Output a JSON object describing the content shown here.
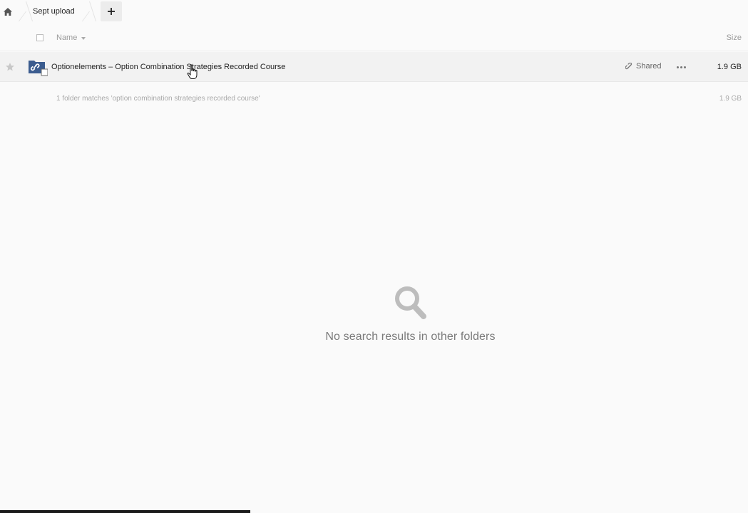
{
  "breadcrumb": {
    "home_icon": "home-icon",
    "folder": "Sept upload",
    "add_icon": "plus-icon"
  },
  "table": {
    "columns": {
      "name": "Name",
      "size": "Size"
    },
    "rows": [
      {
        "name": "Optionelements – Option Combination Strategies Recorded Course",
        "type_icon": "shared-folder-icon",
        "shared_label": "Shared",
        "shared_icon": "link-icon",
        "actions_icon": "more-icon",
        "size": "1.9 GB"
      }
    ]
  },
  "summary": {
    "text": "1 folder matches 'option combination strategies recorded course'",
    "size": "1.9 GB"
  },
  "empty_state": {
    "icon": "search-icon",
    "message": "No search results in other folders"
  },
  "progress": {
    "fraction": 0.335
  },
  "colors": {
    "background": "#fafafa",
    "row_hover": "#f2f2f2",
    "folder_icon": "#3b5c8f",
    "muted_text": "#aaaaaa",
    "progress_bar": "#1a1a1a"
  }
}
